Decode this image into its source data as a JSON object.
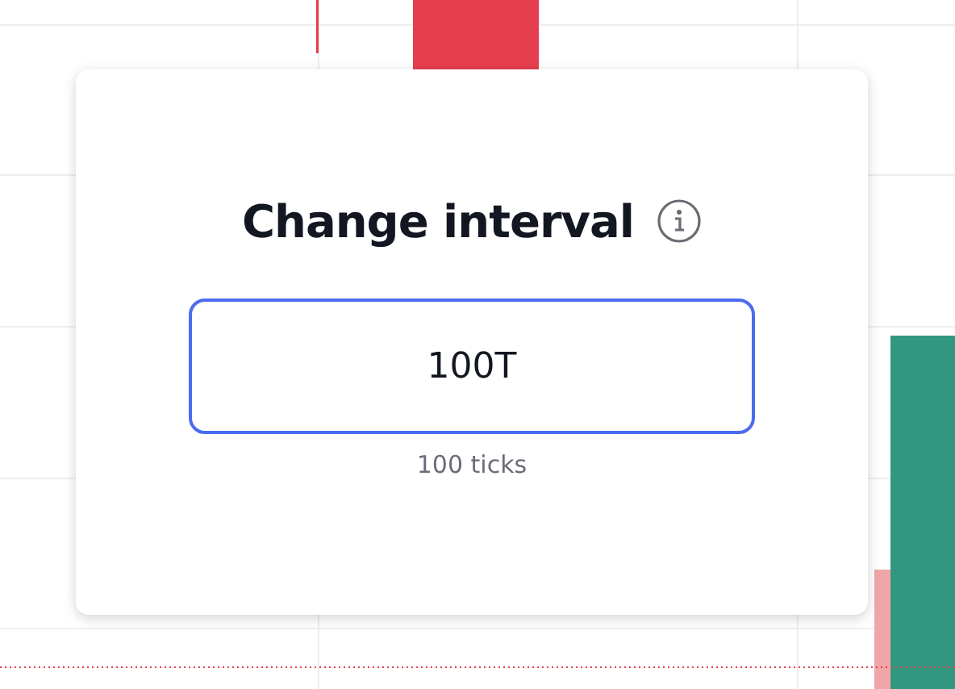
{
  "dialog": {
    "title": "Change interval",
    "input": {
      "value": "100T"
    },
    "hint": "100 ticks"
  }
}
